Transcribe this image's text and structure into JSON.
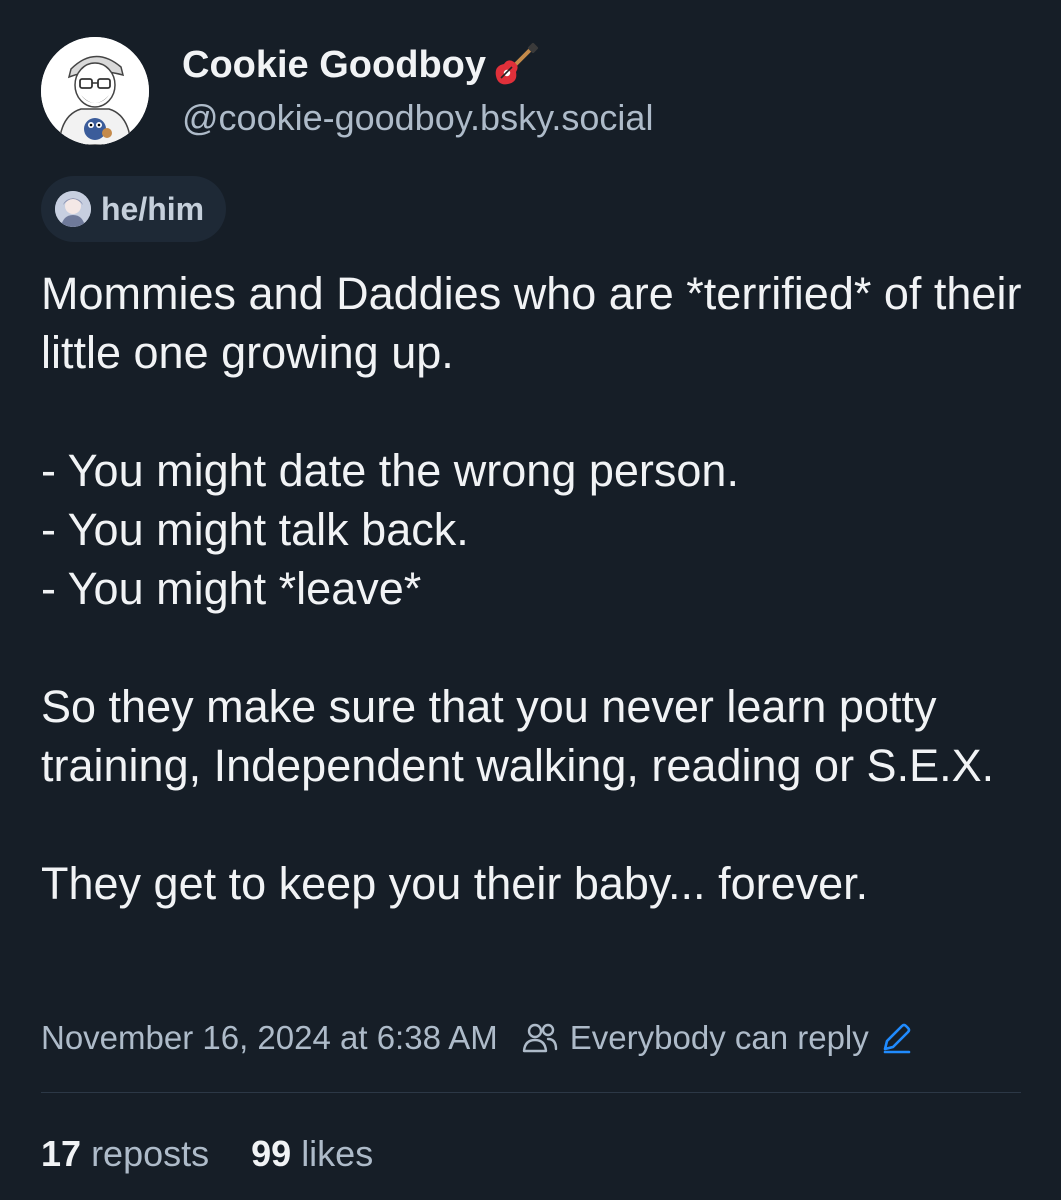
{
  "author": {
    "display_name": "Cookie Goodboy",
    "handle": "@cookie-goodboy.bsky.social",
    "name_emoji_icon": "electric-guitar-icon",
    "pronouns": "he/him"
  },
  "post": {
    "paragraphs": [
      [
        "Mommies and Daddies who are *terrified* of their little one growing up."
      ],
      [
        "- You might date the wrong person.",
        "- You might talk back.",
        "- You might *leave*"
      ],
      [
        "So they make sure that you never learn potty training, Independent walking, reading or S.E.X."
      ],
      [
        "They get to keep you their baby... forever."
      ]
    ],
    "timestamp": "November 16, 2024 at 6:38 AM",
    "reply_setting": "Everybody can reply"
  },
  "stats": {
    "reposts_count": "17",
    "reposts_label": "reposts",
    "likes_count": "99",
    "likes_label": "likes"
  },
  "colors": {
    "background": "#161e27",
    "text": "#f1f3f5",
    "muted": "#aebbc9",
    "accent": "#208bfe"
  }
}
